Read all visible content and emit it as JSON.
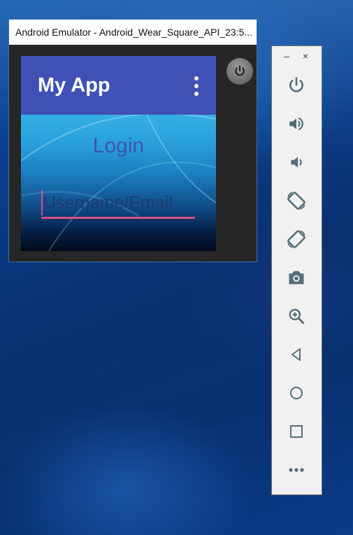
{
  "window": {
    "title": "Android Emulator - Android_Wear_Square_API_23:5..."
  },
  "app": {
    "title": "My App",
    "login_label": "Login",
    "username_placeholder": "Username/Email",
    "username_value": ""
  },
  "side_panel": {
    "minimize_label": "–",
    "close_label": "×",
    "buttons": [
      {
        "icon": "power-icon"
      },
      {
        "icon": "volume-up-icon"
      },
      {
        "icon": "volume-down-icon"
      },
      {
        "icon": "rotate-left-icon"
      },
      {
        "icon": "rotate-right-icon"
      },
      {
        "icon": "camera-icon"
      },
      {
        "icon": "zoom-in-icon"
      },
      {
        "icon": "back-icon"
      },
      {
        "icon": "home-icon"
      },
      {
        "icon": "overview-icon"
      },
      {
        "icon": "more-icon"
      }
    ]
  },
  "colors": {
    "toolbar": "#3f51b5",
    "accent": "#e04a84",
    "panel_icon": "#546e7a"
  }
}
